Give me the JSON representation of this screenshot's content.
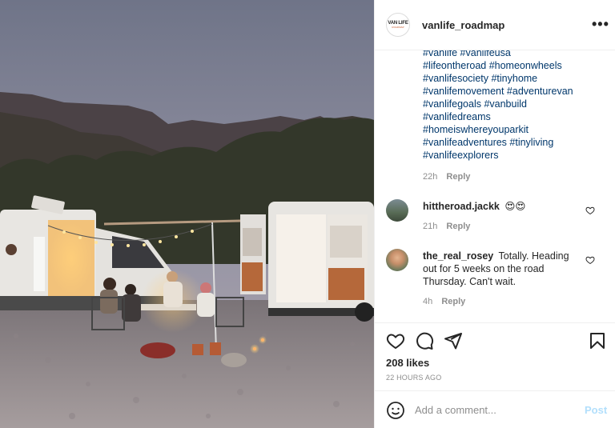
{
  "post": {
    "username": "vanlife_roadmap",
    "avatar_text": [
      "VAN LIFE",
      "ROADMAP"
    ],
    "more_label": "•••"
  },
  "caption": {
    "hashtags": [
      "#vanlife #vanlifeusa",
      "#lifeontheroad #homeonwheels",
      "#vanlifesociety #tinyhome",
      "#vanlifemovement #adventurevan",
      "#vanlifegoals #vanbuild",
      "#vanlifedreams",
      "#homeiswhereyouparkit",
      "#vanlifeadventures #tinyliving",
      "#vanlifeexplorers"
    ],
    "time": "22h",
    "reply_label": "Reply"
  },
  "comments": [
    {
      "username": "hittheroad.jackk",
      "text": "😍😍",
      "time": "21h",
      "reply_label": "Reply"
    },
    {
      "username": "the_real_rosey",
      "text": "Totally. Heading out for 5 weeks on the road Thursday. Can't wait.",
      "time": "4h",
      "reply_label": "Reply"
    }
  ],
  "stats": {
    "likes": "208 likes",
    "posted": "22 HOURS AGO"
  },
  "composer": {
    "placeholder": "Add a comment...",
    "post_label": "Post"
  },
  "colors": {
    "hashtag": "#00376b",
    "post_button_disabled": "#b2dffc",
    "meta": "#8e8e8e"
  }
}
